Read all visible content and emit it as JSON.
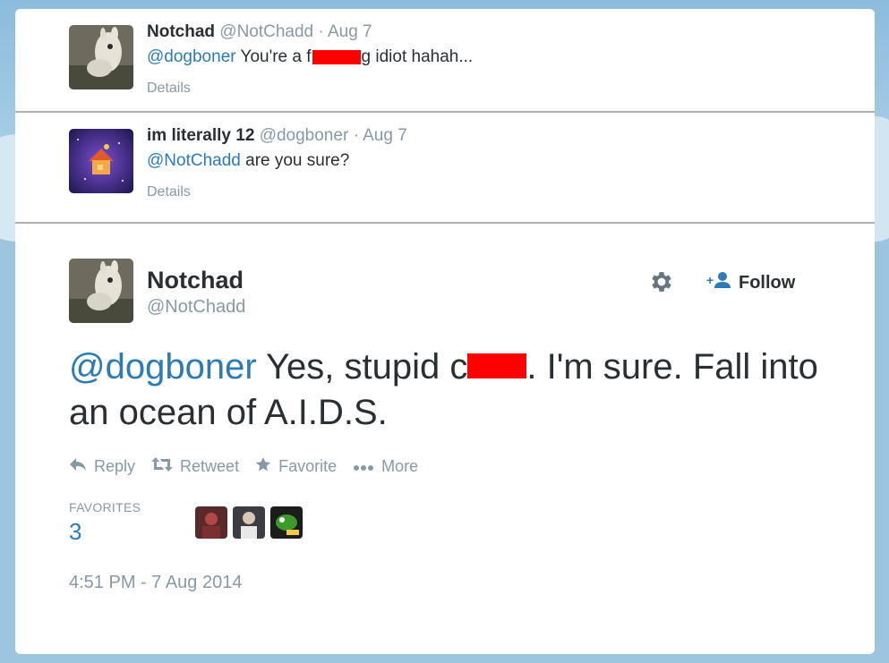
{
  "replies": [
    {
      "name": "Notchad",
      "handle": "@NotChadd",
      "separator": "·",
      "date": "Aug 7",
      "mention": "@dogboner",
      "text_before": " You're a f",
      "text_after": "g idiot hahah...",
      "details": "Details"
    },
    {
      "name": "im literally 12",
      "handle": "@dogboner",
      "separator": "·",
      "date": "Aug 7",
      "mention": "@NotChadd",
      "text": " are you sure?",
      "details": "Details"
    }
  ],
  "main": {
    "name": "Notchad",
    "handle": "@NotChadd",
    "follow_label": "Follow",
    "mention": "@dogboner",
    "text_before": " Yes, stupid c",
    "text_after": ". I'm sure. Fall into an ocean of A.I.D.S.",
    "actions": {
      "reply": "Reply",
      "retweet": "Retweet",
      "favorite": "Favorite",
      "more": "More"
    },
    "favorites_label": "FAVORITES",
    "favorites_count": "3",
    "timestamp": "4:51 PM - 7 Aug 2014"
  },
  "colors": {
    "link": "#2b7bb9",
    "muted": "#8899a6",
    "text": "#292f33",
    "redaction": "#ff0000"
  },
  "icons": [
    "gear-icon",
    "follow-person-icon",
    "reply-icon",
    "retweet-icon",
    "favorite-star-icon",
    "more-dots-icon"
  ]
}
